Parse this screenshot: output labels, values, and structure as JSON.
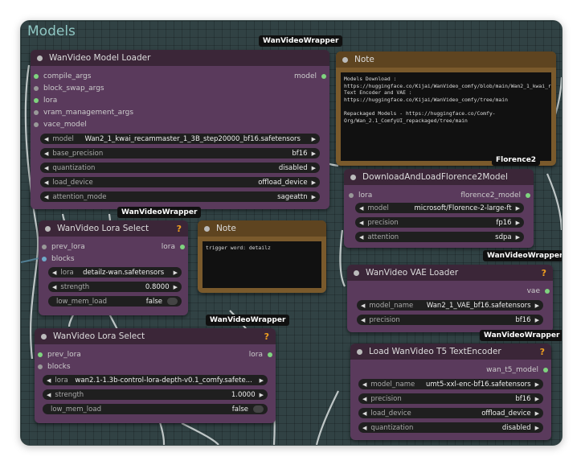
{
  "group_title": "Models",
  "badges": {
    "wanvideo_wrapper": "WanVideoWrapper",
    "florence2": "Florence2"
  },
  "model_loader": {
    "title": "WanVideo Model Loader",
    "inputs": [
      "compile_args",
      "block_swap_args",
      "lora",
      "vram_management_args",
      "vace_model"
    ],
    "output": "model",
    "widgets": [
      {
        "label": "model",
        "value": "Wan2_1_kwai_recammaster_1_3B_step20000_bf16.safetensors"
      },
      {
        "label": "base_precision",
        "value": "bf16"
      },
      {
        "label": "quantization",
        "value": "disabled"
      },
      {
        "label": "load_device",
        "value": "offload_device"
      },
      {
        "label": "attention_mode",
        "value": "sageattn"
      }
    ]
  },
  "note1": {
    "title": "Note",
    "text": "Models Download :\nhttps://huggingface.co/Kijai/WanVideo_comfy/blob/main/Wan2_1_kwai_recammaster_1_3B_step20000_bf16.safetensors\nText Encoder and VAE :\nhttps://huggingface.co/Kijai/WanVideo_comfy/tree/main\n\nRepackaged Models - https://huggingface.co/Comfy-Org/Wan_2.1_ComfyUI_repackaged/tree/main"
  },
  "florence": {
    "title": "DownloadAndLoadFlorence2Model",
    "input": "lora",
    "output": "florence2_model",
    "widgets": [
      {
        "label": "model",
        "value": "microsoft/Florence-2-large-ft"
      },
      {
        "label": "precision",
        "value": "fp16"
      },
      {
        "label": "attention",
        "value": "sdpa"
      }
    ]
  },
  "lora1": {
    "title": "WanVideo Lora Select",
    "q": "?",
    "inputs": [
      "prev_lora",
      "blocks"
    ],
    "output": "lora",
    "widgets": [
      {
        "label": "lora",
        "value": "detailz-wan.safetensors"
      },
      {
        "label": "strength",
        "value": "0.8000"
      },
      {
        "label": "low_mem_load",
        "value": "false"
      }
    ]
  },
  "note2": {
    "title": "Note",
    "text": "trigger word: detailz"
  },
  "vae": {
    "title": "WanVideo VAE Loader",
    "q": "?",
    "output": "vae",
    "widgets": [
      {
        "label": "model_name",
        "value": "Wan2_1_VAE_bf16.safetensors"
      },
      {
        "label": "precision",
        "value": "bf16"
      }
    ]
  },
  "lora2": {
    "title": "WanVideo Lora Select",
    "q": "?",
    "inputs": [
      "prev_lora",
      "blocks"
    ],
    "output": "lora",
    "widgets": [
      {
        "label": "lora",
        "value": "wan2.1-1.3b-control-lora-depth-v0.1_comfy.safete..."
      },
      {
        "label": "strength",
        "value": "1.0000"
      },
      {
        "label": "low_mem_load",
        "value": "false"
      }
    ]
  },
  "t5": {
    "title": "Load WanVideo T5 TextEncoder",
    "q": "?",
    "output": "wan_t5_model",
    "widgets": [
      {
        "label": "model_name",
        "value": "umt5-xxl-enc-bf16.safetensors"
      },
      {
        "label": "precision",
        "value": "bf16"
      },
      {
        "label": "load_device",
        "value": "offload_device"
      },
      {
        "label": "quantization",
        "value": "disabled"
      }
    ]
  },
  "colors": {
    "node_body": "#5a3a5c",
    "node_header": "#3b2638",
    "note_body": "#7a5a2c",
    "canvas": "#314244",
    "group_title": "#8fc7c3",
    "accent_question": "#f0a020"
  }
}
